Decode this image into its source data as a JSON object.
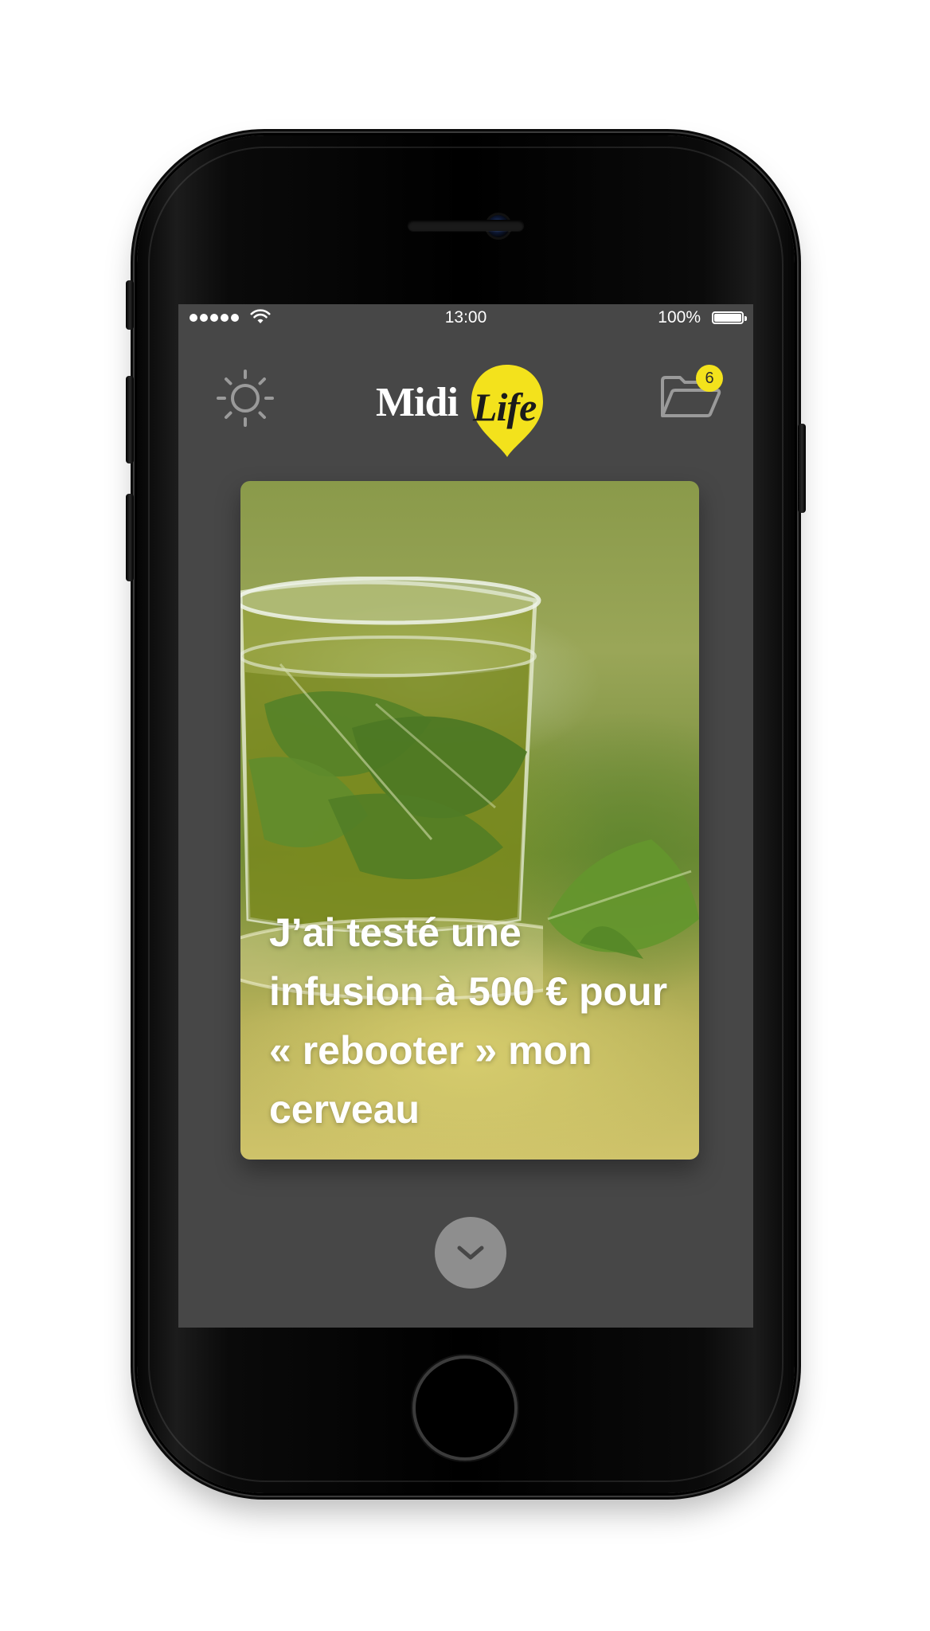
{
  "status_bar": {
    "time": "13:00",
    "battery_percent": "100%",
    "signal_icon": "signal-dots-icon",
    "wifi_icon": "wifi-icon",
    "battery_icon": "battery-full-icon"
  },
  "header": {
    "theme_toggle_icon": "sun-icon",
    "logo": {
      "midi": "Midi",
      "life": "Life"
    },
    "folder_icon": "folder-open-icon",
    "folder_badge": "6"
  },
  "article": {
    "title": "J’ai testé une infusion à 500 € pour « rebooter » mon cerveau",
    "image_icon": "nettle-tea-photo"
  },
  "navigation": {
    "scroll_down_icon": "chevron-down-icon"
  },
  "colors": {
    "screen_background": "#474747",
    "accent_yellow": "#f3e21c",
    "icon_gray": "#9a9a9a",
    "button_gray": "#8e8e8e"
  }
}
